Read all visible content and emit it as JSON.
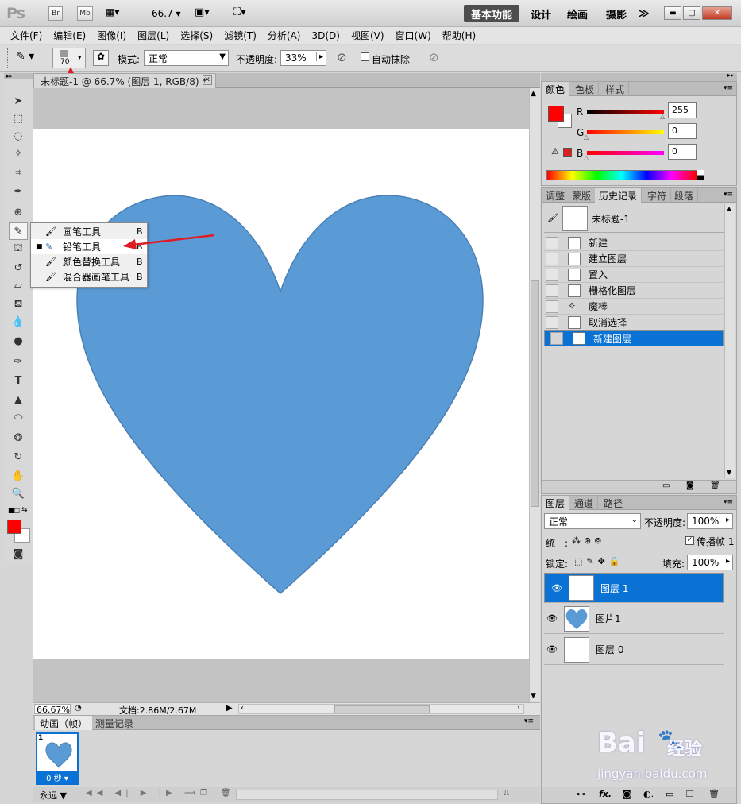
{
  "titlebar": {
    "logo": "Ps",
    "br": "Br",
    "mb": "Mb",
    "zoom": "66.7",
    "workspaces": [
      "基本功能",
      "设计",
      "绘画",
      "摄影"
    ],
    "more": "≫"
  },
  "menu": [
    "文件(F)",
    "编辑(E)",
    "图像(I)",
    "图层(L)",
    "选择(S)",
    "滤镜(T)",
    "分析(A)",
    "3D(D)",
    "视图(V)",
    "窗口(W)",
    "帮助(H)"
  ],
  "options": {
    "brush_size": "70",
    "mode_label": "模式:",
    "mode_value": "正常",
    "opacity_label": "不透明度:",
    "opacity_value": "33%",
    "auto_erase_label": "自动抹除"
  },
  "document": {
    "tab_title": "未标题-1 @ 66.7% (图层 1, RGB/8) *",
    "zoom_status": "66.67%",
    "doc_size": "文档:2.86M/2.67M"
  },
  "flyout": {
    "items": [
      {
        "label": "画笔工具",
        "key": "B",
        "active": false,
        "icon": "brush-icon"
      },
      {
        "label": "铅笔工具",
        "key": "B",
        "active": true,
        "icon": "pencil-icon"
      },
      {
        "label": "颜色替换工具",
        "key": "B",
        "active": false,
        "icon": "color-replace-icon"
      },
      {
        "label": "混合器画笔工具",
        "key": "B",
        "active": false,
        "icon": "mixer-brush-icon"
      }
    ]
  },
  "color_panel": {
    "tabs": [
      "颜色",
      "色板",
      "样式"
    ],
    "r_label": "R",
    "g_label": "G",
    "b_label": "B",
    "r": "255",
    "g": "0",
    "b": "0",
    "fg_color": "#ff0000",
    "bg_color": "#ffffff"
  },
  "history_panel": {
    "tabs": [
      "调整",
      "蒙版",
      "历史记录",
      "字符",
      "段落"
    ],
    "snapshot": "未标题-1",
    "items": [
      "新建",
      "建立图层",
      "置入",
      "栅格化图层",
      "魔棒",
      "取消选择",
      "新建图层"
    ]
  },
  "layers_panel": {
    "tabs": [
      "图层",
      "通道",
      "路径"
    ],
    "blend_mode": "正常",
    "opacity_label": "不透明度:",
    "opacity": "100%",
    "unify_label": "统一:",
    "propagate_label": "传播帧 1",
    "lock_label": "锁定:",
    "fill_label": "填充:",
    "fill": "100%",
    "layers": [
      {
        "name": "图层 1",
        "selected": true
      },
      {
        "name": "图片1",
        "selected": false
      },
      {
        "name": "图层 0",
        "selected": false
      }
    ]
  },
  "anim_panel": {
    "tabs": [
      "动画（帧）",
      "测量记录"
    ],
    "frame_number": "1",
    "frame_delay": "0 秒",
    "loop": "永远"
  },
  "watermark": {
    "brand": "Bai",
    "brand2": "经验",
    "url": "jingyan.baidu.com"
  },
  "colors": {
    "heart": "#5b9bd5",
    "selection": "#0a72d4",
    "arrow": "#e01b24"
  }
}
